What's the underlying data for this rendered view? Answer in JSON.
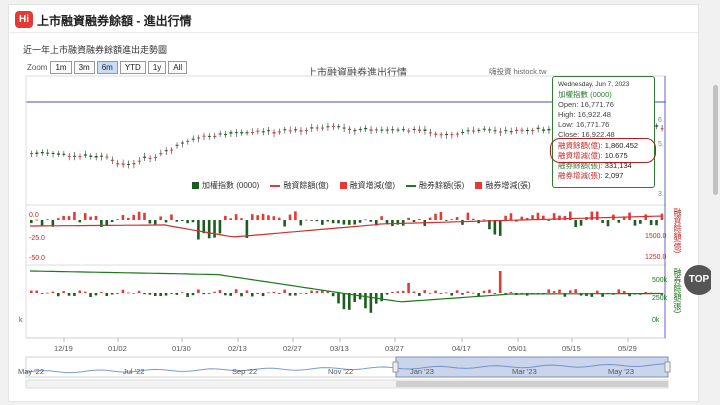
{
  "header": {
    "logo": "Hi",
    "title": "上市融資融券餘額 - 進出行情"
  },
  "subtitle": "近一年上市融資融券餘額進出走勢圖",
  "zoom": {
    "label": "Zoom",
    "buttons": [
      "1m",
      "3m",
      "6m",
      "YTD",
      "1y",
      "All"
    ],
    "active": "6m"
  },
  "watermark": "嗨投資 histock.tw",
  "chart_data": {
    "type": "candlestick-bar-combo",
    "title": "上市融資融券進出行情",
    "x_ticks": [
      "12/19",
      "01/02",
      "01/30",
      "02/13",
      "02/27",
      "03/13",
      "03/27",
      "04/17",
      "05/01",
      "05/15",
      "05/29"
    ],
    "navigator_ticks": [
      "May '22",
      "Jul '22",
      "Sep '22",
      "Nov '22",
      "Jan '23",
      "Mar '23",
      "May '23"
    ],
    "series": [
      {
        "name": "加權指數 (0000)",
        "kind": "candlestick",
        "color_up": "#e53935",
        "color_down": "#1b5e20"
      },
      {
        "name": "融資餘額(億)",
        "kind": "line",
        "color": "#e53935"
      },
      {
        "name": "融資增減(億)",
        "kind": "bar",
        "color": "#e53935"
      },
      {
        "name": "融券餘額(張)",
        "kind": "line",
        "color": "#1b7a1b"
      },
      {
        "name": "融券增減(張)",
        "kind": "bar",
        "color": "#e53935"
      }
    ],
    "panel2_left_ticks": [
      "0.0",
      "-25.0",
      "-50.0"
    ],
    "panel2_right_ticks": [
      "1500.0",
      "1250.0"
    ],
    "panel2_ylabel": "融資餘額(億)",
    "panel3_right_ticks": [
      "500k",
      "250k",
      "0k"
    ],
    "panel3_left_ticks": [
      "k"
    ],
    "panel3_ylabel": "融券餘額(張)",
    "panel1_right_ticks": [
      "6.",
      "5.",
      "3."
    ],
    "tooltip": {
      "date": "Wednesday, Jun 7, 2023",
      "index_name": "加權指數 (0000)",
      "open_label": "Open:",
      "open": "16,771.76",
      "high_label": "High:",
      "high": "16,922.48",
      "low_label": "Low:",
      "low": "16,771.76",
      "close_label": "Close:",
      "close": "16,922.48",
      "margin_balance_label": "融資餘額(億):",
      "margin_balance": "1,860.452",
      "margin_change_label": "融資增減(億):",
      "margin_change": "10.675",
      "short_balance_label": "融券餘額(張):",
      "short_balance": "331,134",
      "short_change_label": "融券增減(張):",
      "short_change": "2,097"
    }
  },
  "top_button": "TOP",
  "colors": {
    "up": "#e53935",
    "down": "#1b5e20",
    "line_red": "#d32f2f",
    "line_green": "#1b7a1b",
    "accent": "#3f51b5"
  }
}
